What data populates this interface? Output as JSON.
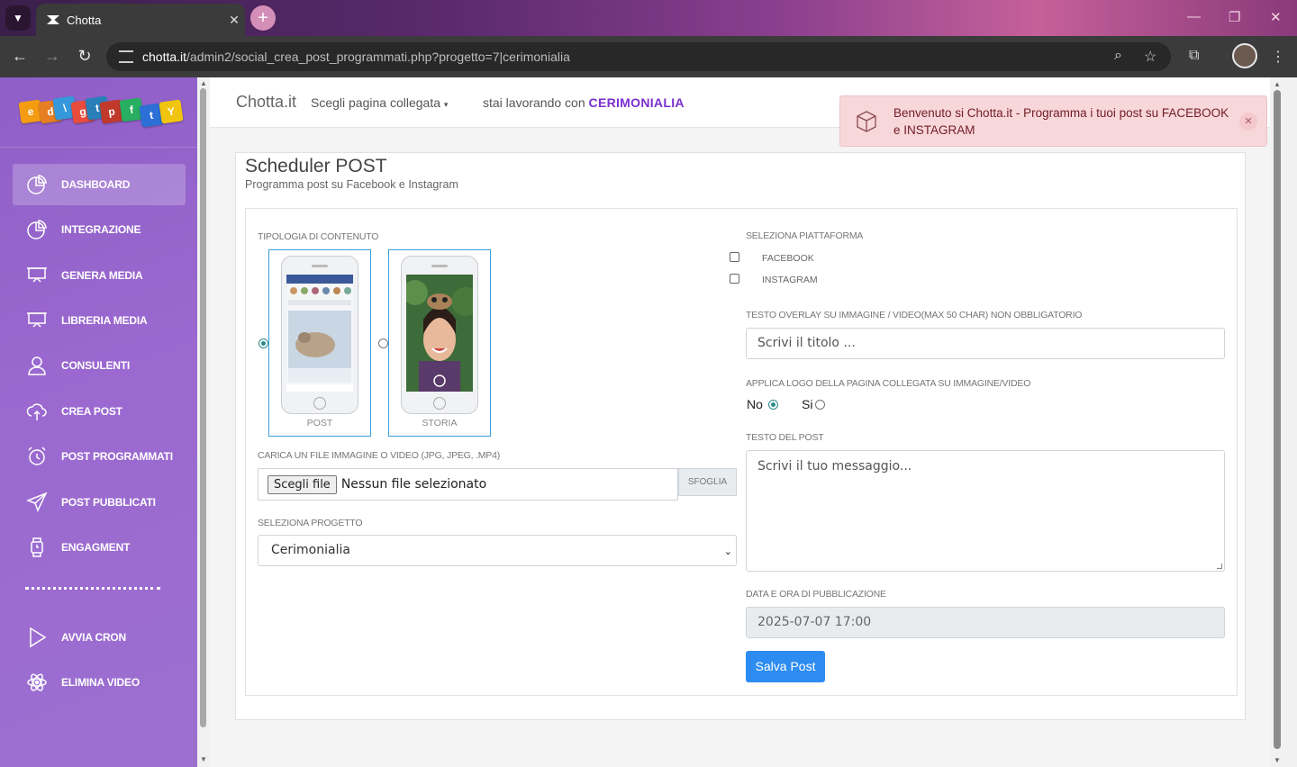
{
  "browser": {
    "tab_title": "Chotta",
    "url_host": "chotta.it",
    "url_path": "/admin2/social_crea_post_programmati.php?progetto=7|cerimonialia"
  },
  "sidebar": {
    "items": [
      {
        "label": "DASHBOARD",
        "icon": "pie-chart-icon",
        "active": true
      },
      {
        "label": "INTEGRAZIONE",
        "icon": "pie-chart-icon"
      },
      {
        "label": "GENERA MEDIA",
        "icon": "projector-icon"
      },
      {
        "label": "LIBRERIA MEDIA",
        "icon": "projector-icon"
      },
      {
        "label": "CONSULENTI",
        "icon": "user-icon"
      },
      {
        "label": "CREA POST",
        "icon": "cloud-upload-icon"
      },
      {
        "label": "POST PROGRAMMATI",
        "icon": "alarm-clock-icon"
      },
      {
        "label": "POST PUBBLICATI",
        "icon": "paper-plane-icon"
      },
      {
        "label": "ENGAGMENT",
        "icon": "watch-icon"
      },
      {
        "label": "AVVIA CRON",
        "icon": "play-icon"
      },
      {
        "label": "ELIMINA VIDEO",
        "icon": "atom-icon"
      }
    ]
  },
  "topbar": {
    "brand": "Chotta.it",
    "page_select": "Scegli pagina collegata",
    "working_prefix": "stai lavorando con",
    "working_project": "CERIMONIALIA"
  },
  "alert": {
    "text": "Benvenuto si Chotta.it - Programma i tuoi post su FACEBOOK e INSTAGRAM",
    "close": "✕"
  },
  "card": {
    "title": "Scheduler POST",
    "subtitle": "Programma post su Facebook e Instagram"
  },
  "form": {
    "content_type_label": "TIPOLOGIA DI CONTENUTO",
    "content_types": [
      {
        "label": "POST",
        "selected": true
      },
      {
        "label": "STORIA",
        "selected": false
      }
    ],
    "upload_label": "CARICA UN FILE IMMAGINE O VIDEO (JPG, JPEG, .MP4)",
    "file_button": "Scegli file",
    "file_status": "Nessun file selezionato",
    "browse_label": "SFOGLIA",
    "project_label": "SELEZIONA PROGETTO",
    "project_value": "Cerimonialia",
    "platform_label": "SELEZIONA PIATTAFORMA",
    "platforms": [
      {
        "label": "FACEBOOK",
        "checked": false
      },
      {
        "label": "INSTAGRAM",
        "checked": false
      }
    ],
    "overlay_label": "TESTO OVERLAY SU IMMAGINE / VIDEO(MAX 50 CHAR) NON OBBLIGATORIO",
    "overlay_placeholder": "Scrivi il titolo ...",
    "logo_label": "APPLICA LOGO DELLA PAGINA COLLEGATA SU IMMAGINE/VIDEO",
    "logo_no": "No",
    "logo_si": "Si",
    "logo_selected": "No",
    "post_text_label": "TESTO DEL POST",
    "post_text_placeholder": "Scrivi il tuo messaggio...",
    "date_label": "DATA E ORA DI PUBBLICAZIONE",
    "date_value": "2025-07-07 17:00",
    "save_label": "Salva Post"
  },
  "colors": {
    "sidebar": "#9b69d0",
    "accent": "#2d8cf0",
    "project_highlight": "#7a2fd0",
    "alert_bg": "#f7d7da"
  }
}
